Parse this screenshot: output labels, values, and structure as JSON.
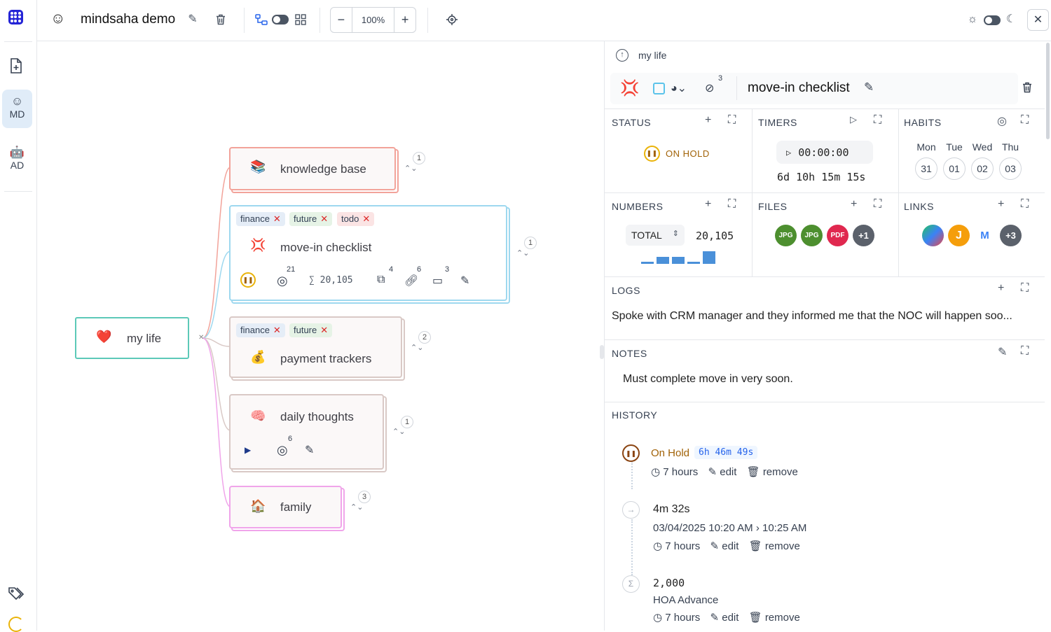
{
  "app": {
    "title": "mindsaha demo",
    "title_emoji": "☺",
    "zoom": "100%",
    "zoom_minus": "−",
    "zoom_plus": "+"
  },
  "rail": {
    "items": [
      {
        "emoji": "☺",
        "label": "MD",
        "active": true
      },
      {
        "emoji": "🤖",
        "label": "AD",
        "active": false
      }
    ]
  },
  "canvas": {
    "root": {
      "emoji": "❤️",
      "label": "my life"
    },
    "nodes": [
      {
        "id": "kb",
        "emoji": "📚",
        "label": "knowledge base",
        "count": "1",
        "color": "#f2a39a"
      },
      {
        "id": "move",
        "emoji": "💢",
        "label": "move-in checklist",
        "count": "1",
        "color": "#9ed8ef",
        "tags": [
          "finance",
          "future",
          "todo"
        ],
        "meta": {
          "habits": "21",
          "sum": "∑ 20,105",
          "files": "4",
          "links": "6",
          "logs": "3"
        }
      },
      {
        "id": "pay",
        "emoji": "💰",
        "label": "payment trackers",
        "count": "2",
        "color": "#d9c9c6",
        "tags": [
          "finance",
          "future"
        ]
      },
      {
        "id": "daily",
        "emoji": "🧠",
        "label": "daily thoughts",
        "count": "1",
        "color": "#d9c9c6",
        "meta": {
          "habits": "6"
        }
      },
      {
        "id": "family",
        "emoji": "🏠",
        "label": "family",
        "count": "3",
        "color": "#f0a5ea"
      }
    ]
  },
  "panel": {
    "breadcrumb": "my life",
    "emoji": "💢",
    "tag_count": "3",
    "title": "move-in checklist",
    "status": {
      "title": "STATUS",
      "value": "ON HOLD"
    },
    "timers": {
      "title": "TIMERS",
      "value": "00:00:00",
      "total": "6d 10h 15m 15s"
    },
    "habits": {
      "title": "HABITS",
      "days": [
        "Mon",
        "Tue",
        "Wed",
        "Thu"
      ],
      "dates": [
        "31",
        "01",
        "02",
        "03"
      ]
    },
    "numbers": {
      "title": "NUMBERS",
      "select": "TOTAL",
      "value": "20,105",
      "bars": [
        0.15,
        0.55,
        0.55,
        0.15,
        1.0
      ]
    },
    "files": {
      "title": "FILES",
      "items": [
        {
          "label": "JPG",
          "color": "#4d8f2f"
        },
        {
          "label": "JPG",
          "color": "#4d8f2f"
        },
        {
          "label": "PDF",
          "color": "#e0284f"
        },
        {
          "label": "+1",
          "color": "#5b616b"
        }
      ]
    },
    "links": {
      "title": "LINKS",
      "more": "+3"
    },
    "logs": {
      "title": "LOGS",
      "text": "Spoke with CRM manager and they informed me that the NOC will happen soo..."
    },
    "notes": {
      "title": "NOTES",
      "text": "Must complete move in very soon."
    },
    "history": {
      "title": "HISTORY",
      "entries": [
        {
          "status": "On Hold",
          "duration": "6h 46m 49s",
          "ago": "7 hours",
          "edit": "edit",
          "remove": "remove"
        },
        {
          "headline": "4m 32s",
          "range_date": "03/04/2025",
          "range_from": "10:20 AM",
          "range_sep": "›",
          "range_to": "10:25 AM",
          "ago": "7 hours",
          "edit": "edit",
          "remove": "remove"
        },
        {
          "headline": "2,000",
          "sub": "HOA Advance",
          "ago": "7 hours",
          "edit": "edit",
          "remove": "remove"
        }
      ]
    }
  },
  "colors": {
    "accent": "#2424d6",
    "status_hold": "#eab308",
    "bar": "#4a90d9"
  }
}
